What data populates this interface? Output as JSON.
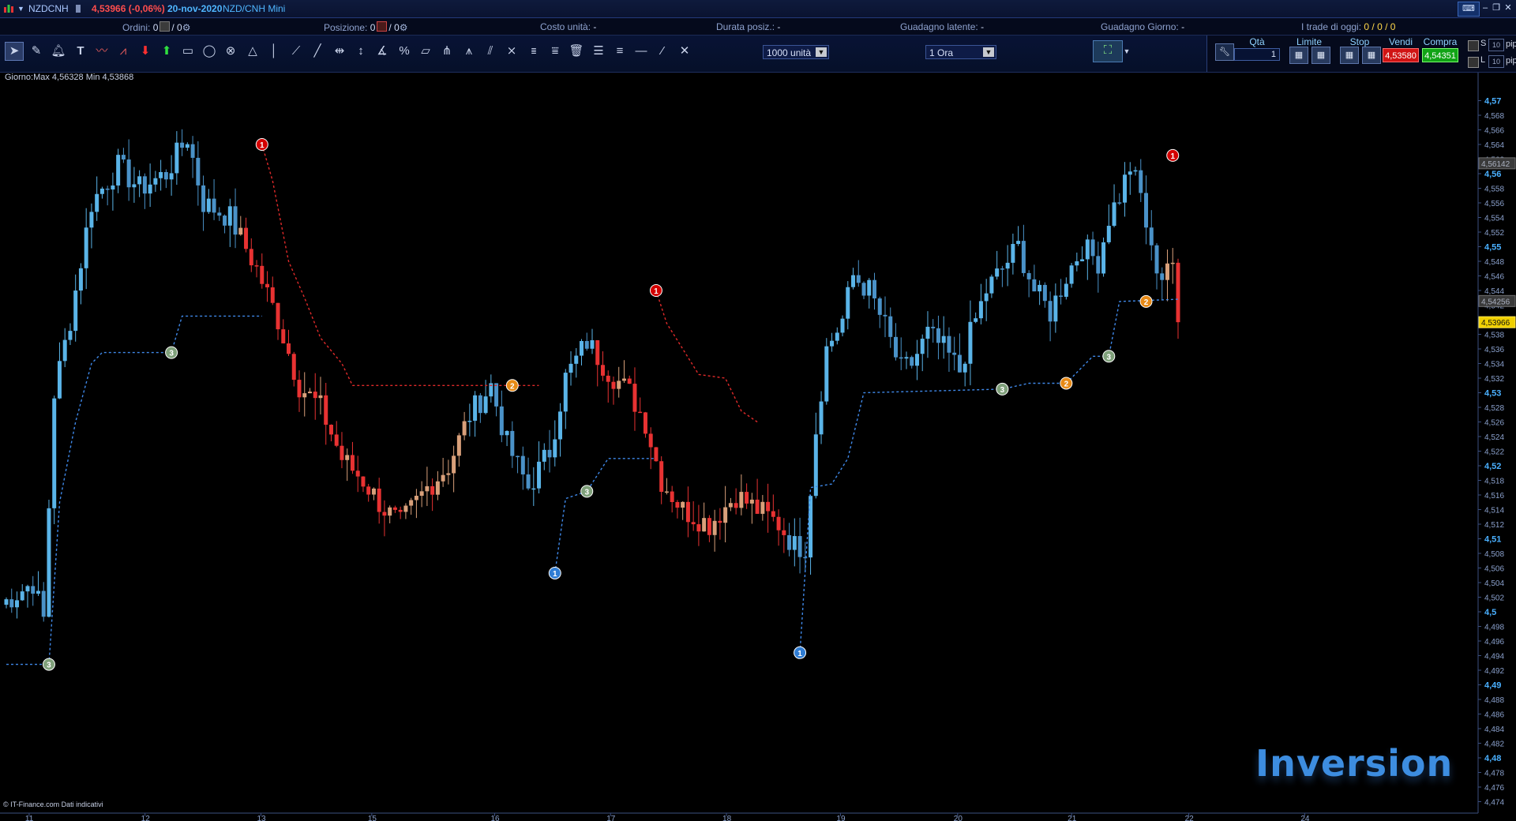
{
  "titlebar": {
    "symbol": "NZDCNH",
    "price_change": "4,53966 (-0,06%)",
    "date": "20-nov-2020",
    "instrument": "NZD/CNH Mini"
  },
  "statusbar": {
    "orders_label": "Ordini:",
    "orders_value": "0",
    "orders_sep": "/ 0",
    "position_label": "Posizione:",
    "position_value": "0",
    "position_sep": "/ 0",
    "cost_label": "Costo unità:",
    "cost_value": "-",
    "duration_label": "Durata posiz.:",
    "duration_value": "-",
    "latent_label": "Guadagno latente:",
    "latent_value": "-",
    "daily_label": "Guadagno Giorno:",
    "daily_value": "-",
    "trades_label": "I trade di oggi:",
    "trades_value": "0 / 0 / 0"
  },
  "toolbar": {
    "units_select": "1000 unità",
    "timeframe_select": "1 Ora"
  },
  "order_panel": {
    "qty_label": "Qtà",
    "qty_value": "1",
    "limit_label": "Limite",
    "stop_label": "Stop",
    "sell_label": "Vendi",
    "sell_price": "4,53580",
    "buy_label": "Compra",
    "buy_price": "4,54351",
    "s_label": "S",
    "l_label": "L",
    "s_pips": "10",
    "l_pips": "10",
    "pip_label": "pip"
  },
  "chart_info": "Giorno:Max 4,56328 Min 4,53868",
  "copyright": "© IT-Finance.com Dati indicativi",
  "brand": "Inversion",
  "chart_data": {
    "type": "candlestick",
    "instrument": "NZDCNH",
    "timeframe": "1 Ora",
    "ylim": [
      4.472,
      4.572
    ],
    "y_ticks": [
      "4,57",
      "4,568",
      "4,566",
      "4,564",
      "4,562",
      "4,56",
      "4,558",
      "4,556",
      "4,554",
      "4,552",
      "4,55",
      "4,548",
      "4,546",
      "4,544",
      "4,542",
      "4,54",
      "4,538",
      "4,536",
      "4,534",
      "4,532",
      "4,53",
      "4,528",
      "4,526",
      "4,524",
      "4,522",
      "4,52",
      "4,518",
      "4,516",
      "4,514",
      "4,512",
      "4,51",
      "4,508",
      "4,506",
      "4,504",
      "4,502",
      "4,5",
      "4,498",
      "4,496",
      "4,494",
      "4,492",
      "4,49",
      "4,488",
      "4,486",
      "4,484",
      "4,482",
      "4,48",
      "4,478",
      "4,476",
      "4,474"
    ],
    "y_bold_ticks": [
      "4,57",
      "4,56",
      "4,55",
      "4,54",
      "4,53",
      "4,52",
      "4,51",
      "4,5",
      "4,49",
      "4,48"
    ],
    "price_labels": [
      {
        "value": 4.56142,
        "text": "4,56142",
        "style": "gray"
      },
      {
        "value": 4.54256,
        "text": "4,54256",
        "style": "gray"
      },
      {
        "value": 4.53966,
        "text": "4,53966",
        "style": "yellow"
      }
    ],
    "x_labels": [
      "11",
      "12",
      "13",
      "15",
      "16",
      "17",
      "18",
      "19",
      "20",
      "21",
      "22",
      "24"
    ],
    "candle_anchors": [
      [
        0,
        4.501
      ],
      [
        6,
        4.504
      ],
      [
        8,
        4.499
      ],
      [
        10,
        4.53
      ],
      [
        13,
        4.54
      ],
      [
        17,
        4.556
      ],
      [
        22,
        4.561
      ],
      [
        26,
        4.558
      ],
      [
        31,
        4.56
      ],
      [
        35,
        4.565
      ],
      [
        38,
        4.556
      ],
      [
        43,
        4.554
      ],
      [
        48,
        4.547
      ],
      [
        52,
        4.54
      ],
      [
        56,
        4.531
      ],
      [
        60,
        4.528
      ],
      [
        64,
        4.521
      ],
      [
        68,
        4.518
      ],
      [
        72,
        4.514
      ],
      [
        75,
        4.512
      ],
      [
        80,
        4.517
      ],
      [
        84,
        4.52
      ],
      [
        88,
        4.527
      ],
      [
        92,
        4.531
      ],
      [
        95,
        4.523
      ],
      [
        99,
        4.517
      ],
      [
        103,
        4.522
      ],
      [
        106,
        4.532
      ],
      [
        110,
        4.537
      ],
      [
        114,
        4.533
      ],
      [
        118,
        4.53
      ],
      [
        121,
        4.526
      ],
      [
        124,
        4.518
      ],
      [
        128,
        4.514
      ],
      [
        133,
        4.512
      ],
      [
        138,
        4.516
      ],
      [
        142,
        4.514
      ],
      [
        146,
        4.512
      ],
      [
        149,
        4.509
      ],
      [
        151,
        4.509
      ],
      [
        153,
        4.525
      ],
      [
        155,
        4.536
      ],
      [
        158,
        4.54
      ],
      [
        160,
        4.546
      ],
      [
        163,
        4.544
      ],
      [
        166,
        4.539
      ],
      [
        169,
        4.533
      ],
      [
        171,
        4.534
      ],
      [
        174,
        4.538
      ],
      [
        177,
        4.536
      ],
      [
        180,
        4.533
      ],
      [
        182,
        4.538
      ],
      [
        185,
        4.544
      ],
      [
        188,
        4.547
      ],
      [
        191,
        4.55
      ],
      [
        194,
        4.544
      ],
      [
        197,
        4.541
      ],
      [
        200,
        4.546
      ],
      [
        203,
        4.55
      ],
      [
        206,
        4.548
      ],
      [
        208,
        4.554
      ],
      [
        210,
        4.557
      ],
      [
        212,
        4.561
      ],
      [
        214,
        4.557
      ],
      [
        216,
        4.549
      ],
      [
        218,
        4.546
      ],
      [
        219,
        4.548
      ],
      [
        220,
        4.541
      ]
    ],
    "indicators": {
      "support_line_color": "#3f88e8",
      "resistance_line_color": "#e02a2a",
      "markers": [
        {
          "label": "3",
          "color": "#7fa07a",
          "type": "support",
          "x": 8,
          "y": 4.4928
        },
        {
          "label": "3",
          "color": "#7fa07a",
          "type": "support",
          "x": 31,
          "y": 4.5355
        },
        {
          "label": "1",
          "color": "#d40000",
          "type": "resistance",
          "x": 48,
          "y": 4.564
        },
        {
          "label": "2",
          "color": "#e88a16",
          "type": "resistance",
          "x": 95,
          "y": 4.531
        },
        {
          "label": "1",
          "color": "#2f7cd3",
          "type": "support",
          "x": 103,
          "y": 4.5053
        },
        {
          "label": "3",
          "color": "#7fa07a",
          "type": "support",
          "x": 109,
          "y": 4.5165
        },
        {
          "label": "1",
          "color": "#d40000",
          "type": "resistance",
          "x": 122,
          "y": 4.544
        },
        {
          "label": "1",
          "color": "#2f7cd3",
          "type": "support",
          "x": 149,
          "y": 4.4944
        },
        {
          "label": "3",
          "color": "#7fa07a",
          "type": "support",
          "x": 187,
          "y": 4.5305
        },
        {
          "label": "2",
          "color": "#e88a16",
          "type": "support",
          "x": 199,
          "y": 4.5313
        },
        {
          "label": "3",
          "color": "#7fa07a",
          "type": "support",
          "x": 207,
          "y": 4.535
        },
        {
          "label": "2",
          "color": "#e88a16",
          "type": "support",
          "x": 214,
          "y": 4.5425
        },
        {
          "label": "1",
          "color": "#d40000",
          "type": "resistance",
          "x": 219,
          "y": 4.5625
        }
      ]
    },
    "colors": {
      "bull": "#5ab4e8",
      "bear": "#e83232",
      "bear_alt": "#d9a07a"
    }
  }
}
